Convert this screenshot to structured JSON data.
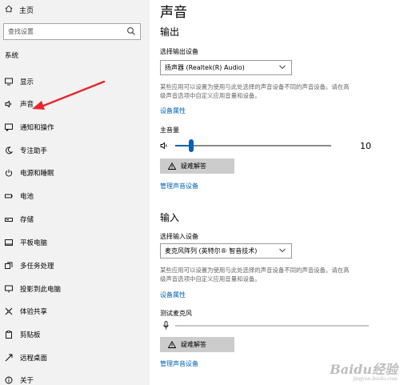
{
  "sidebar": {
    "home_label": "主页",
    "search_placeholder": "查找设置",
    "section_label": "系统",
    "items": [
      {
        "label": "显示",
        "icon": "monitor-icon"
      },
      {
        "label": "声音",
        "icon": "speaker-icon"
      },
      {
        "label": "通知和操作",
        "icon": "message-icon"
      },
      {
        "label": "专注助手",
        "icon": "moon-icon"
      },
      {
        "label": "电源和睡眠",
        "icon": "power-icon"
      },
      {
        "label": "电池",
        "icon": "battery-icon"
      },
      {
        "label": "存储",
        "icon": "storage-icon"
      },
      {
        "label": "平板电脑",
        "icon": "tablet-icon"
      },
      {
        "label": "多任务处理",
        "icon": "multitask-icon"
      },
      {
        "label": "投影到此电脑",
        "icon": "projector-icon"
      },
      {
        "label": "体验共享",
        "icon": "share-icon"
      },
      {
        "label": "剪贴板",
        "icon": "clipboard-icon"
      },
      {
        "label": "远程桌面",
        "icon": "remote-icon"
      },
      {
        "label": "关于",
        "icon": "info-icon"
      }
    ]
  },
  "main": {
    "title": "声音",
    "output": {
      "heading": "输出",
      "device_label": "选择输出设备",
      "device_value": "扬声器 (Realtek(R) Audio)",
      "desc_line1": "某些应用可以设置为使用与此处选择的声音设备不同的声音设备。请在高",
      "desc_line2": "级声音选项中自定义应用音量和设备。",
      "properties_link": "设备属性",
      "volume_label": "主音量",
      "volume_value": "10",
      "volume_level": 0.1,
      "troubleshoot_label": "疑难解答",
      "manage_link": "管理声音设备"
    },
    "input": {
      "heading": "输入",
      "device_label": "选择输入设备",
      "device_value": "麦克风阵列 (英特尔® 智音技术)",
      "desc_line1": "某些应用可以设置为使用与此处选择的声音设备不同的声音设备。请在高",
      "desc_line2": "级声音选项中自定义应用音量和设备。",
      "properties_link": "设备属性",
      "test_label": "测试麦克风",
      "troubleshoot_label": "疑难解答",
      "manage_link": "管理声音设备"
    }
  },
  "watermark": {
    "brand": "Baidu经验",
    "url": "jingyan.baidu.com"
  },
  "colors": {
    "sidebar_bg": "#f2f2f2",
    "accent": "#0063b1",
    "annotation_arrow": "#e8262b",
    "button_bg": "#cccccc"
  }
}
